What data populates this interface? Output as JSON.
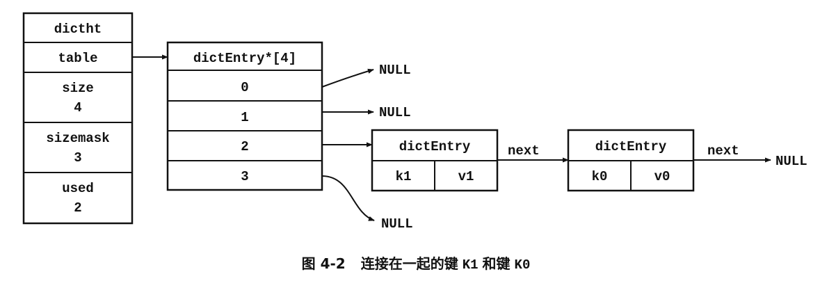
{
  "dictht": {
    "title": "dictht",
    "table": "table",
    "size_label": "size",
    "size_value": "4",
    "sizemask_label": "sizemask",
    "sizemask_value": "3",
    "used_label": "used",
    "used_value": "2"
  },
  "array": {
    "title": "dictEntry*[4]",
    "indices": [
      "0",
      "1",
      "2",
      "3"
    ]
  },
  "entry_k1": {
    "title": "dictEntry",
    "key": "k1",
    "value": "v1"
  },
  "entry_k0": {
    "title": "dictEntry",
    "key": "k0",
    "value": "v0"
  },
  "labels": {
    "null": "NULL",
    "next": "next"
  },
  "caption": {
    "figure": "图 4-2",
    "text_prefix": "连接在一起的键",
    "k1": "K1",
    "text_mid": "和键",
    "k0": "K0"
  },
  "colors": {
    "ink": "#111111",
    "background": "#ffffff"
  }
}
